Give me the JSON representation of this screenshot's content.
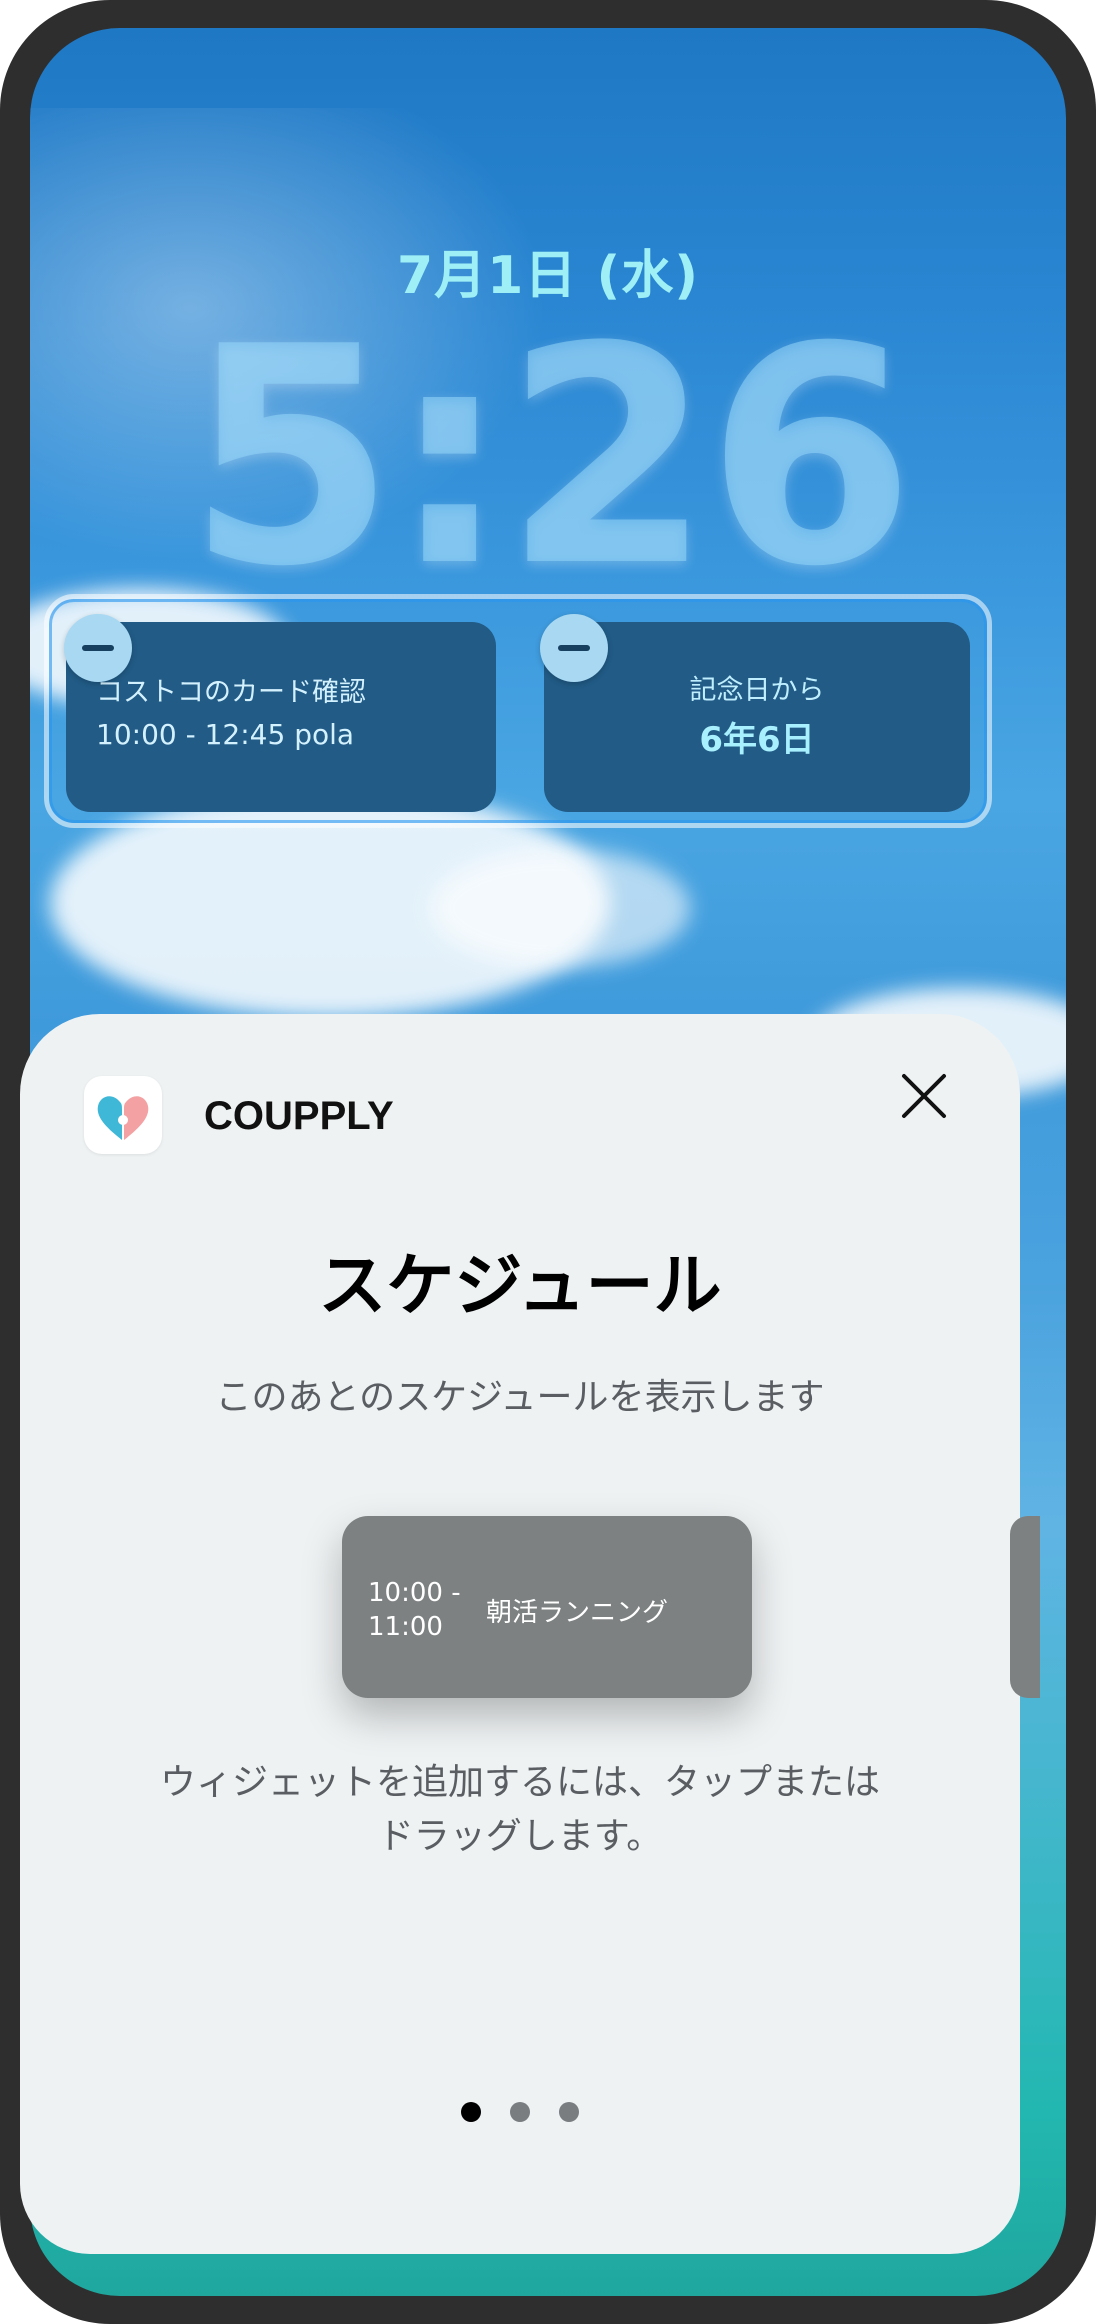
{
  "lockscreen": {
    "date": "7月1日 (水)",
    "time": "5:26"
  },
  "widgets": [
    {
      "title": "コストコのカード確認",
      "subtitle": "10:00 - 12:45 pola"
    },
    {
      "title": "記念日から",
      "value": "6年6日"
    }
  ],
  "sheet": {
    "app_name": "COUPPLY",
    "title": "スケジュール",
    "description": "このあとのスケジュールを表示します",
    "preview": {
      "time_line1": "10:00 -",
      "time_line2": "11:00",
      "title": "朝活ランニング"
    },
    "hint_line1": "ウィジェットを追加するには、タップまたは",
    "hint_line2": "ドラッグします。",
    "page_count": 3,
    "current_page": 1
  },
  "colors": {
    "date_text": "#9ff0f6",
    "widget_bg": "#215b86",
    "sheet_bg": "#eef2f3",
    "preview_bg": "#7d8182"
  }
}
